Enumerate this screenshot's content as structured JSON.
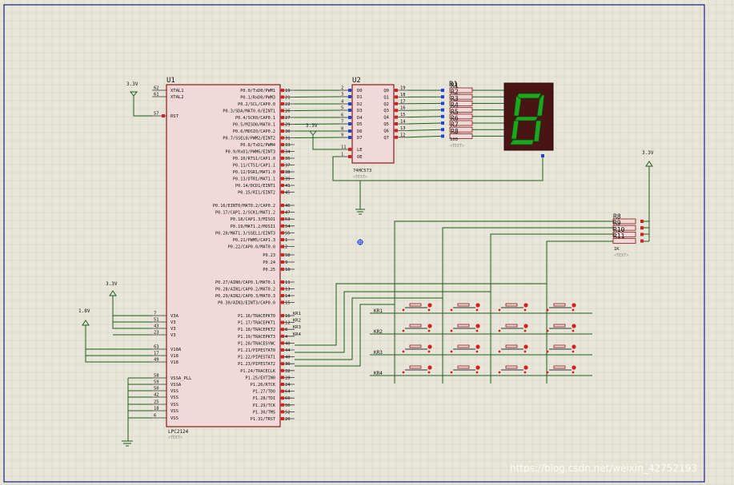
{
  "colors": {
    "background": "#e8e6d9",
    "grid": "#d3d1c2",
    "border": "#1a1a8c",
    "chip_fill": "#f1d9d9",
    "chip_stroke": "#8b1a1a",
    "wire": "#1f5c1f",
    "pin_red": "#d62020",
    "pin_blue": "#2040e0",
    "text": "#111111",
    "text_grey": "#8a8a8a",
    "segment_on": "#1fa51f",
    "display_bg": "#4a1414"
  },
  "u1": {
    "ref": "U1",
    "part": "LPC2124",
    "text_tag": "<TEXT>",
    "left_pins": [
      {
        "num": "62",
        "name": "XTAL1"
      },
      {
        "num": "61",
        "name": "XTAL2"
      },
      {
        "num": "57",
        "name": "RST"
      },
      {
        "num": "7",
        "name": "V3A"
      },
      {
        "num": "51",
        "name": "V3"
      },
      {
        "num": "43",
        "name": "V3"
      },
      {
        "num": "23",
        "name": "V3"
      },
      {
        "num": "63",
        "name": "V18A"
      },
      {
        "num": "17",
        "name": "V18"
      },
      {
        "num": "49",
        "name": "V18"
      },
      {
        "num": "58",
        "name": "VSSA_PLL"
      },
      {
        "num": "59",
        "name": "VSSA"
      },
      {
        "num": "50",
        "name": "VSS"
      },
      {
        "num": "42",
        "name": "VSS"
      },
      {
        "num": "25",
        "name": "VSS"
      },
      {
        "num": "18",
        "name": "VSS"
      },
      {
        "num": "6",
        "name": "VSS"
      }
    ],
    "right_pins": [
      {
        "num": "19",
        "name": "P0.0/TxD0/PWM1"
      },
      {
        "num": "21",
        "name": "P0.1/RxD0/PWM3"
      },
      {
        "num": "22",
        "name": "P0.2/SCL/CAP0.0"
      },
      {
        "num": "26",
        "name": "P0.3/SDA/MAT0.0/EINT1"
      },
      {
        "num": "27",
        "name": "P0.4/SCK0/CAP0.1"
      },
      {
        "num": "29",
        "name": "P0.5/MISO0/MAT0.1"
      },
      {
        "num": "30",
        "name": "P0.6/MOSI0/CAP0.2"
      },
      {
        "num": "31",
        "name": "P0.7/SSEL0/PWM2/EINT2"
      },
      {
        "num": "33",
        "name": "P0.8/TxD1/PWM4"
      },
      {
        "num": "34",
        "name": "P0.9/RxD1/PWM6/EINT3"
      },
      {
        "num": "35",
        "name": "P0.10/RTS1/CAP1.0"
      },
      {
        "num": "37",
        "name": "P0.11/CTS1/CAP1.1"
      },
      {
        "num": "38",
        "name": "P0.12/DSR1/MAT1.0"
      },
      {
        "num": "39",
        "name": "P0.13/DTR1/MAT1.1"
      },
      {
        "num": "41",
        "name": "P0.14/DCD1/EINT1"
      },
      {
        "num": "45",
        "name": "P0.15/RI1/EINT2"
      },
      {
        "num": "46",
        "name": "P0.16/EINT0/MAT0.2/CAP0.2"
      },
      {
        "num": "47",
        "name": "P0.17/CAP1.2/SCK1/MAT1.2"
      },
      {
        "num": "53",
        "name": "P0.18/CAP1.3/MISO1"
      },
      {
        "num": "54",
        "name": "P0.19/MAT1.2/MOSI1"
      },
      {
        "num": "55",
        "name": "P0.20/MAT1.3/SSEL1/EINT3"
      },
      {
        "num": "1",
        "name": "P0.21/PWM5/CAP1.3"
      },
      {
        "num": "2",
        "name": "P0.22/CAP0.0/MAT0.0"
      },
      {
        "num": "58",
        "name": "P0.23"
      },
      {
        "num": "9",
        "name": "P0.24"
      },
      {
        "num": "10",
        "name": "P0.25"
      },
      {
        "num": "11",
        "name": "P0.27/AIN0/CAP0.1/MAT0.1"
      },
      {
        "num": "13",
        "name": "P0.28/AIN1/CAP0.2/MAT0.2"
      },
      {
        "num": "14",
        "name": "P0.29/AIN2/CAP0.3/MAT0.3"
      },
      {
        "num": "15",
        "name": "P0.30/AIN3/EINT3/CAP0.0"
      },
      {
        "num": "16",
        "name": "P1.16/TRACEPKT0"
      },
      {
        "num": "12",
        "name": "P1.17/TRACEPKT1"
      },
      {
        "num": "8",
        "name": "P1.18/TRACEPKT2"
      },
      {
        "num": "4",
        "name": "P1.19/TRACEPKT3"
      },
      {
        "num": "48",
        "name": "P1.20/TRACESYNC"
      },
      {
        "num": "44",
        "name": "P1.21/PIPESTAT0"
      },
      {
        "num": "40",
        "name": "P1.22/PIPESTAT1"
      },
      {
        "num": "36",
        "name": "P1.23/PIPESTAT2"
      },
      {
        "num": "32",
        "name": "P1.24/TRACECLK"
      },
      {
        "num": "28",
        "name": "P1.25/EXTIN0"
      },
      {
        "num": "24",
        "name": "P1.26/RTCK"
      },
      {
        "num": "64",
        "name": "P1.27/TDO"
      },
      {
        "num": "60",
        "name": "P1.28/TDI"
      },
      {
        "num": "56",
        "name": "P1.29/TCK"
      },
      {
        "num": "52",
        "name": "P1.30/TMS"
      },
      {
        "num": "20",
        "name": "P1.31/TRST"
      }
    ]
  },
  "u2": {
    "ref": "U2",
    "part": "74HC573",
    "text_tag": "<TEXT>",
    "left_pins": [
      {
        "num": "2",
        "name": "D0"
      },
      {
        "num": "3",
        "name": "D1"
      },
      {
        "num": "4",
        "name": "D2"
      },
      {
        "num": "5",
        "name": "D3"
      },
      {
        "num": "6",
        "name": "D4"
      },
      {
        "num": "7",
        "name": "D5"
      },
      {
        "num": "8",
        "name": "D6"
      },
      {
        "num": "9",
        "name": "D7"
      },
      {
        "num": "11",
        "name": "LE"
      },
      {
        "num": "1",
        "name": "OE"
      }
    ],
    "right_pins": [
      {
        "num": "19",
        "name": "Q0"
      },
      {
        "num": "18",
        "name": "Q1"
      },
      {
        "num": "17",
        "name": "Q2"
      },
      {
        "num": "16",
        "name": "Q3"
      },
      {
        "num": "15",
        "name": "Q4"
      },
      {
        "num": "14",
        "name": "Q5"
      },
      {
        "num": "13",
        "name": "Q6"
      },
      {
        "num": "12",
        "name": "Q7"
      }
    ]
  },
  "r1": {
    "ref": "R1",
    "labels": [
      "R1",
      "R2",
      "R3",
      "R4",
      "R5",
      "R6",
      "R7",
      "R8"
    ],
    "value": "100",
    "text_tag": "<TEXT>"
  },
  "pullups": {
    "labels": [
      "R8",
      "R9",
      "R10",
      "R11"
    ],
    "value": "1K",
    "text_tag": "<TEXT>"
  },
  "power_labels": {
    "vcc_u1_xtal": "3.3V",
    "vcc_u2_le": "3.3V",
    "vcc_v3": "3.3V",
    "vcc_v18": "1.8V",
    "vcc_pullups": "3.3V"
  },
  "keypad": {
    "row_labels": [
      "KR1",
      "KR2",
      "KR3",
      "KR4"
    ],
    "pin_labels": [
      "KR1",
      "KR2",
      "KR3",
      "KR4"
    ],
    "rows": 4,
    "cols": 4
  },
  "seven_segment": {
    "digit": "8"
  },
  "watermark": "https://blog.csdn.net/weixin_42752193"
}
